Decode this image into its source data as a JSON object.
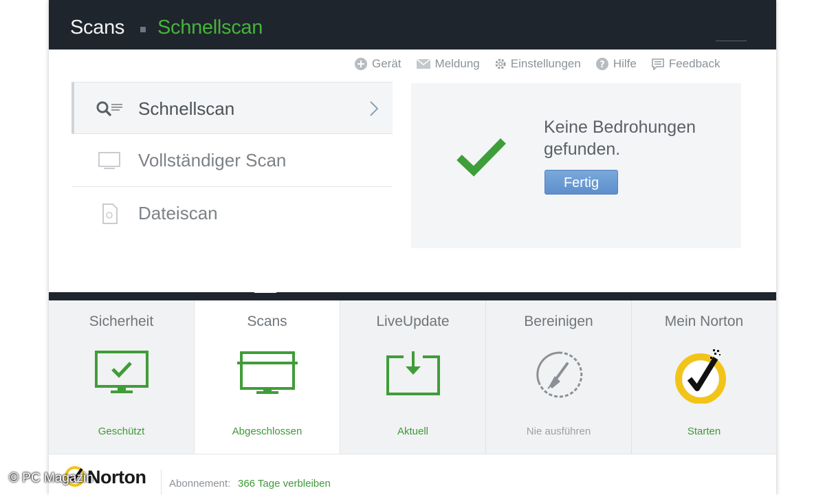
{
  "header": {
    "breadcrumb_root": "Scans",
    "breadcrumb_current": "Schnellscan"
  },
  "toolbar": {
    "items": [
      {
        "label": "Gerät",
        "icon": "plus-circle-icon"
      },
      {
        "label": "Meldung",
        "icon": "envelope-icon"
      },
      {
        "label": "Einstellungen",
        "icon": "gear-icon"
      },
      {
        "label": "Hilfe",
        "icon": "help-icon"
      },
      {
        "label": "Feedback",
        "icon": "feedback-icon"
      }
    ]
  },
  "scan_list": {
    "items": [
      {
        "label": "Schnellscan",
        "icon": "quick-scan-icon",
        "selected": true
      },
      {
        "label": "Vollständiger Scan",
        "icon": "monitor-icon",
        "selected": false
      },
      {
        "label": "Dateiscan",
        "icon": "file-icon",
        "selected": false
      }
    ]
  },
  "result": {
    "message": "Keine Bedrohungen gefunden.",
    "button_label": "Fertig",
    "icon": "checkmark-icon"
  },
  "tiles": [
    {
      "title": "Sicherheit",
      "status": "Geschützt",
      "icon": "monitor-check-icon"
    },
    {
      "title": "Scans",
      "status": "Abgeschlossen",
      "icon": "monitor-scan-icon",
      "selected": true
    },
    {
      "title": "LiveUpdate",
      "status": "Aktuell",
      "icon": "download-box-icon"
    },
    {
      "title": "Bereinigen",
      "status": "Nie ausführen",
      "icon": "broom-gauge-icon"
    },
    {
      "title": "Mein Norton",
      "status": "Starten",
      "icon": "norton-seal-icon"
    }
  ],
  "footer": {
    "logo_text": "Norton",
    "subscription_label": "Abonnement:",
    "subscription_value": "366 Tage verbleiben"
  },
  "watermark": "© PC Magazin",
  "colors": {
    "header_bg": "#1f252c",
    "accent_green": "#44b43a",
    "status_green": "#3c9a35",
    "button_blue": "#6a9ad3",
    "norton_yellow": "#f2c418"
  }
}
